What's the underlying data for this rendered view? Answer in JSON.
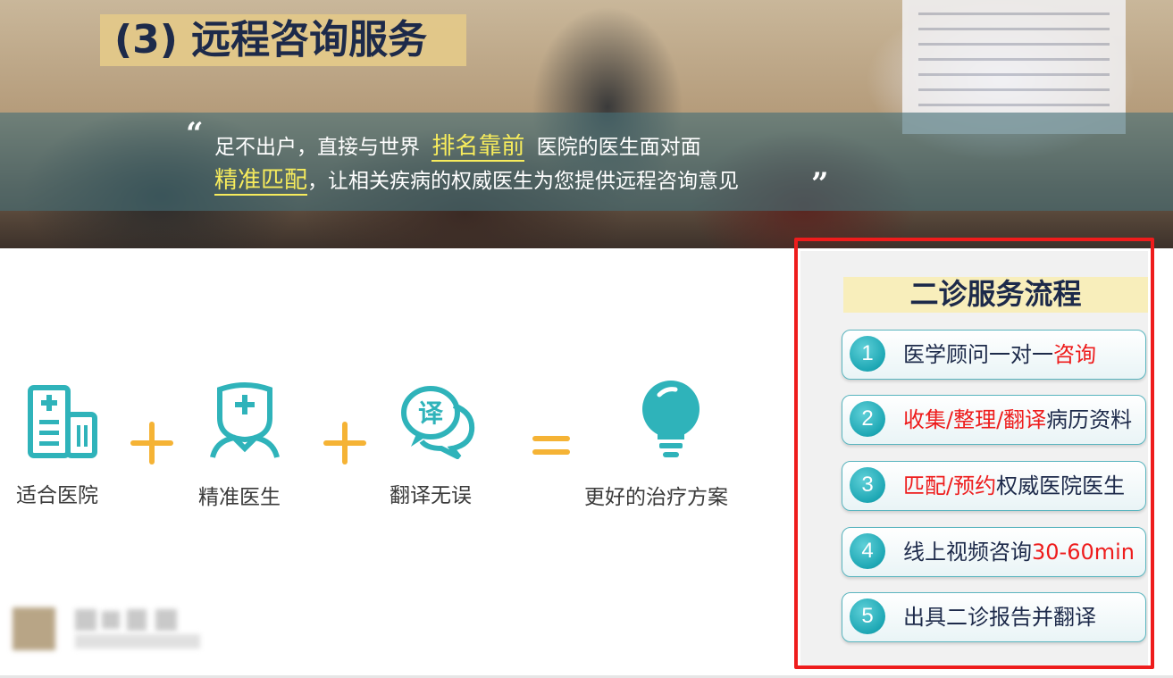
{
  "banner": {
    "title": "(3) 远程咨询服务",
    "quote_open": "“",
    "quote_close": "”",
    "line1_a": "足不出户，直接与世界",
    "line1_hl": "排名靠前",
    "line1_b": "医院的医生面对面",
    "line2_hl": "精准匹配",
    "line2_b": "，让相关疾病的权威医生为您提供远程咨询意见"
  },
  "formula": {
    "items": [
      {
        "icon": "hospital-icon",
        "label": "适合医院"
      },
      {
        "icon": "doctor-icon",
        "label": "精准医生"
      },
      {
        "icon": "translate-icon",
        "label": "翻译无误"
      },
      {
        "icon": "lightbulb-icon",
        "label": "更好的治疗方案"
      }
    ],
    "accent_color": "#f5b335",
    "icon_color": "#2fb3ba"
  },
  "process": {
    "title": "二诊服务流程",
    "highlight_color": "#ee1c1c",
    "steps": [
      {
        "num": "1",
        "parts": [
          {
            "t": "医学顾问一对一",
            "red": false
          },
          {
            "t": "咨询",
            "red": true
          }
        ]
      },
      {
        "num": "2",
        "parts": [
          {
            "t": "收集/整理/翻译",
            "red": true
          },
          {
            "t": "病历资料",
            "red": false
          }
        ]
      },
      {
        "num": "3",
        "parts": [
          {
            "t": "匹配/预约",
            "red": true
          },
          {
            "t": "权威医院医生",
            "red": false
          }
        ]
      },
      {
        "num": "4",
        "parts": [
          {
            "t": "线上视频咨询",
            "red": false
          },
          {
            "t": "30-60min",
            "red": true
          }
        ]
      },
      {
        "num": "5",
        "parts": [
          {
            "t": "出具二诊报告并翻译",
            "red": false
          }
        ]
      }
    ]
  }
}
